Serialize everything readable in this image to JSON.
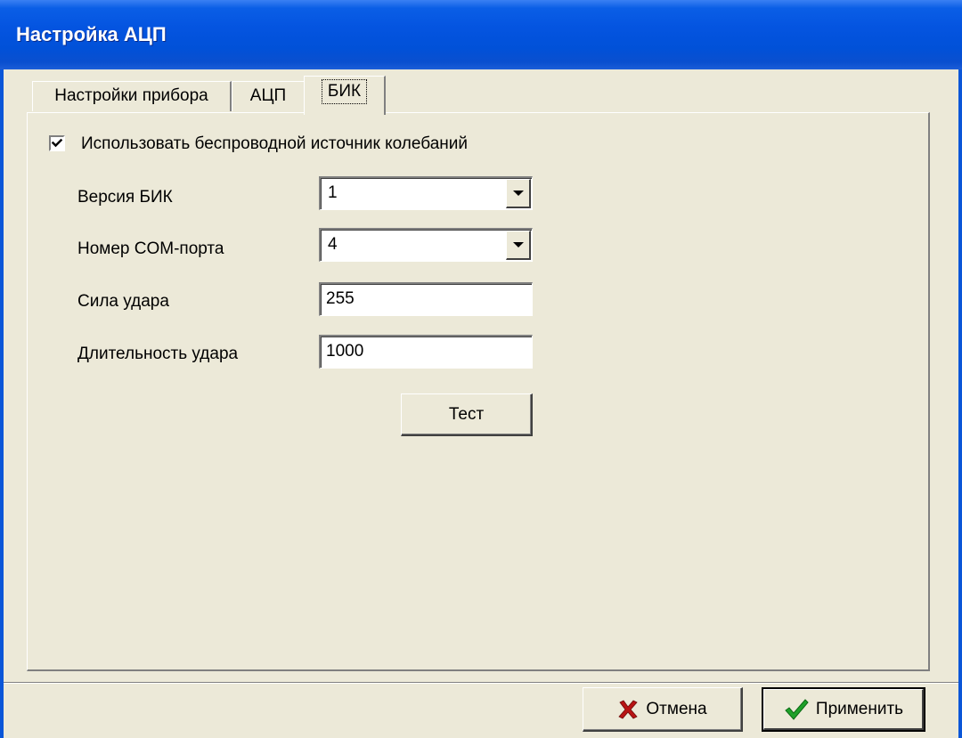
{
  "window": {
    "title": "Настройка АЦП"
  },
  "tabs": [
    {
      "label": "Настройки прибора",
      "selected": false
    },
    {
      "label": "АЦП",
      "selected": false
    },
    {
      "label": "БИК",
      "selected": true
    }
  ],
  "bik": {
    "use_wireless": {
      "label": "Использовать беспроводной источник колебаний",
      "checked": true
    },
    "version": {
      "label": "Версия БИК",
      "value": "1"
    },
    "com_port": {
      "label": "Номер COM-порта",
      "value": "4"
    },
    "force": {
      "label": "Сила удара",
      "value": "255"
    },
    "duration": {
      "label": "Длительность удара",
      "value": "1000"
    },
    "test_label": "Тест"
  },
  "footer": {
    "cancel_label": "Отмена",
    "cancel_icon": "red-x-icon",
    "apply_label": "Применить",
    "apply_icon": "green-checkmark-icon"
  },
  "colors": {
    "titlebar": "#0454e0",
    "window_bg": "#ece9d8",
    "cancel_icon": "#b81414",
    "apply_icon": "#1fa12a"
  }
}
